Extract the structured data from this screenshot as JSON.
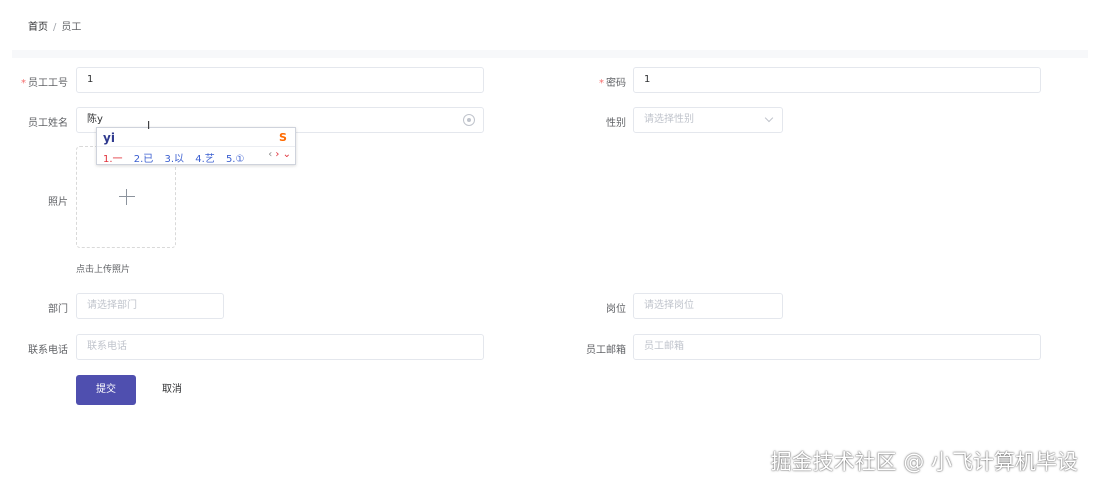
{
  "breadcrumb": {
    "home": "首页",
    "separator": "/",
    "current": "员工"
  },
  "form": {
    "emp_no": {
      "label": "员工工号",
      "required": "*",
      "value": "1"
    },
    "password": {
      "label": "密码",
      "required": "*",
      "value": "1"
    },
    "name": {
      "label": "员工姓名",
      "value": "陈y"
    },
    "gender": {
      "label": "性别",
      "placeholder": "请选择性别"
    },
    "photo": {
      "label": "照片",
      "tip": "点击上传照片"
    },
    "department": {
      "label": "部门",
      "placeholder": "请选择部门"
    },
    "position": {
      "label": "岗位",
      "placeholder": "请选择岗位"
    },
    "phone": {
      "label": "联系电话",
      "placeholder": "联系电话"
    },
    "email": {
      "label": "员工邮箱",
      "placeholder": "员工邮箱"
    }
  },
  "buttons": {
    "submit": "提交",
    "cancel": "取消"
  },
  "ime": {
    "composition": "yi",
    "candidates": [
      "1.一",
      "2.已",
      "3.以",
      "4.艺",
      "5.①"
    ],
    "nav_prev": "‹",
    "nav_next": "›",
    "logo": "S"
  },
  "watermark": "掘金技术社区 @ 小飞计算机毕设",
  "colors": {
    "primary": "#4f4faf",
    "required": "#f56c6c",
    "ime_highlight": "#e0303a"
  }
}
